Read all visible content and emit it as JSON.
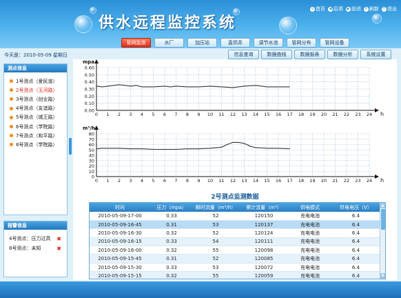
{
  "header": {
    "title": "供水远程监控系统",
    "links": [
      "首页",
      "后退",
      "前进",
      "刷新",
      "退出"
    ]
  },
  "nav": {
    "tabs": [
      "管网监测",
      "水厂",
      "加压站",
      "直供井",
      "调节水池",
      "管网分布",
      "管网设备"
    ],
    "active_tab": "管网监测",
    "subtabs": [
      "信息查询",
      "数据曲线",
      "数据报表",
      "数据分析",
      "系统设置"
    ]
  },
  "date_text": "今天是：2010-05-09 星期日",
  "points_panel": {
    "title": "测点信息",
    "items": [
      "1号测点（爱民道）",
      "2号测点（玉河路）",
      "3号测点（创业路）",
      "4号测点（友谊路）",
      "5号测点（城王路）",
      "6号测点（学院路）",
      "7号测点（和平路）",
      "8号测点（学院路）"
    ],
    "selected_index": 1
  },
  "alarm_panel": {
    "title": "报警信息",
    "items": [
      "4号测点：压力过高",
      "8号测点：未知"
    ]
  },
  "chart_data": [
    {
      "type": "line",
      "ylabel": "mpa",
      "xlabel": "h",
      "ylim": [
        0,
        0.6
      ],
      "yticks": [
        "0.00",
        "0.10",
        "0.20",
        "0.30",
        "0.40",
        "0.50",
        "0.60"
      ],
      "xticks": [
        "0",
        "1",
        "2",
        "3",
        "4",
        "5",
        "6",
        "7",
        "8",
        "9",
        "10",
        "11",
        "12",
        "13",
        "14",
        "15",
        "16",
        "17",
        "18",
        "19",
        "20",
        "21",
        "22",
        "23",
        "24"
      ],
      "x": [
        0,
        0.5,
        1,
        1.5,
        2,
        2.5,
        3,
        3.5,
        4,
        5,
        6,
        6.5,
        7,
        8,
        9,
        10,
        11,
        12,
        13,
        14,
        15,
        16,
        17
      ],
      "values": [
        0.34,
        0.33,
        0.34,
        0.35,
        0.36,
        0.35,
        0.34,
        0.35,
        0.33,
        0.33,
        0.34,
        0.33,
        0.34,
        0.33,
        0.33,
        0.34,
        0.33,
        0.32,
        0.34,
        0.35,
        0.33,
        0.33,
        0.33
      ],
      "grid": true
    },
    {
      "type": "line",
      "ylabel": "m³/h",
      "xlabel": "h",
      "ylim": [
        0,
        80
      ],
      "yticks": [
        "0",
        "10",
        "20",
        "30",
        "40",
        "50",
        "60",
        "70",
        "80"
      ],
      "xticks": [
        "0",
        "1",
        "2",
        "3",
        "4",
        "5",
        "6",
        "7",
        "8",
        "9",
        "10",
        "11",
        "12",
        "13",
        "14",
        "15",
        "16",
        "17",
        "18",
        "19",
        "20",
        "21",
        "22",
        "23",
        "24"
      ],
      "x": [
        0,
        0.5,
        1,
        2,
        3,
        4,
        5,
        6,
        7,
        8,
        9,
        10,
        11,
        11.5,
        12,
        12.5,
        13,
        13.5,
        14,
        15,
        16,
        17
      ],
      "values": [
        52,
        53,
        53,
        53,
        52,
        52,
        51,
        51,
        51,
        52,
        52,
        53,
        55,
        60,
        64,
        64,
        62,
        57,
        54,
        53,
        53,
        52
      ],
      "grid": true
    }
  ],
  "table": {
    "title": "2号测点监测数据",
    "headers": [
      "时间",
      "压力（mpa）",
      "瞬时流量（m³/h）",
      "累计流量（m³）",
      "供电模式",
      "供电电压（V）"
    ],
    "rows": [
      [
        "2010-05-09-17-00",
        "0.33",
        "52",
        "120150",
        "充电电池",
        "6.4"
      ],
      [
        "2010-05-09-16-45",
        "0.31",
        "53",
        "120137",
        "充电电池",
        "6.4"
      ],
      [
        "2010-05-09-16-30",
        "0.32",
        "52",
        "120124",
        "充电电池",
        "6.4"
      ],
      [
        "2010-05-09-16-15",
        "0.33",
        "54",
        "120111",
        "充电电池",
        "6.4"
      ],
      [
        "2010-05-09-16-00",
        "0.32",
        "55",
        "120098",
        "充电电池",
        "6.4"
      ],
      [
        "2010-05-09-15-45",
        "0.31",
        "52",
        "120085",
        "充电电池",
        "6.4"
      ],
      [
        "2010-05-09-15-30",
        "0.33",
        "53",
        "120072",
        "充电电池",
        "6.4"
      ],
      [
        "2010-05-09-15-15",
        "0.32",
        "55",
        "120059",
        "充电电池",
        "6.4"
      ]
    ],
    "selected_row": 1
  },
  "colors": {
    "accent": "#2a7fc4",
    "active_tab": "#d8321c",
    "line": "#333333",
    "grid": "#7fa6c9"
  }
}
